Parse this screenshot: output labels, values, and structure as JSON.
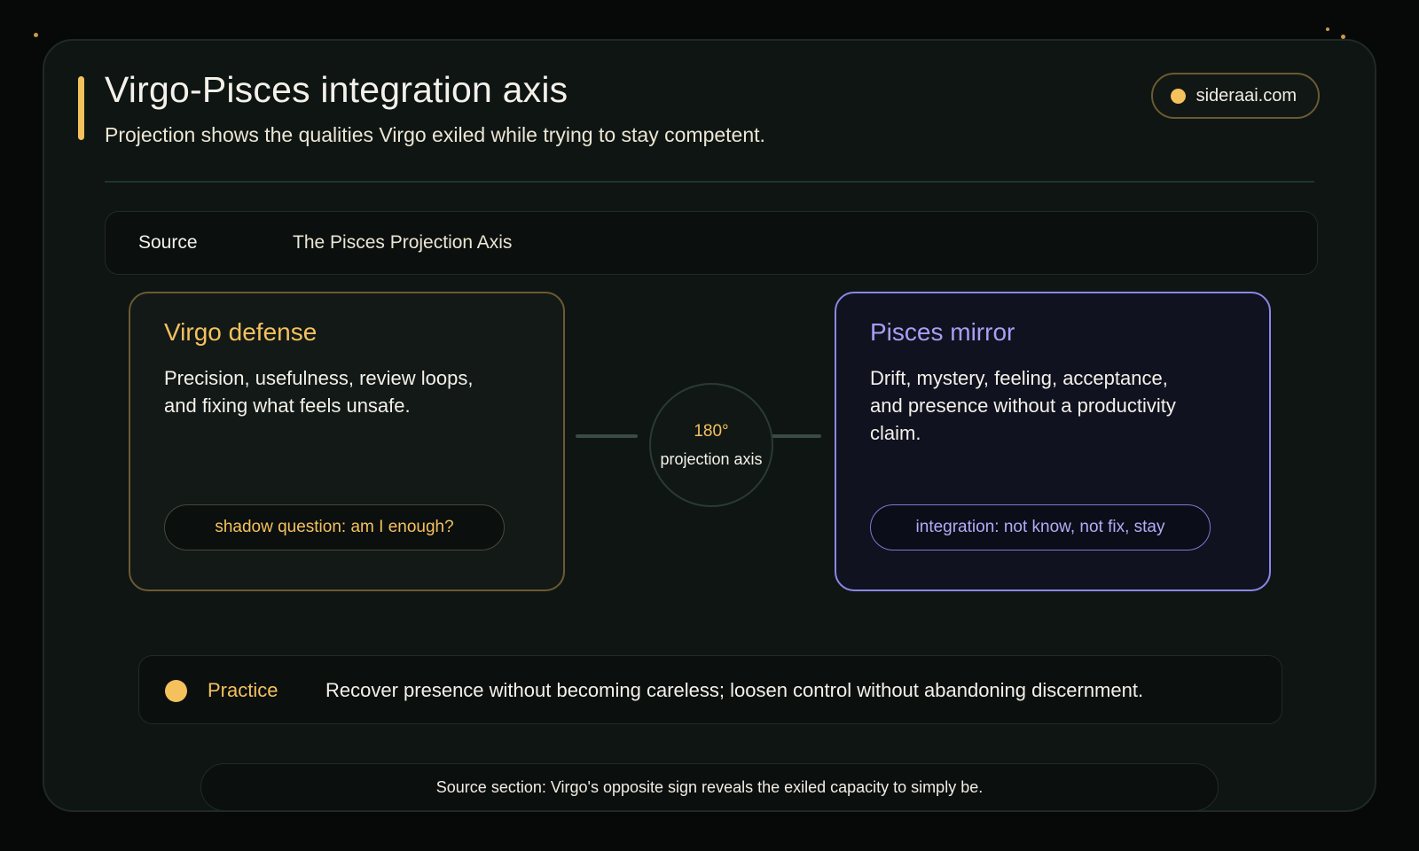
{
  "header": {
    "title": "Virgo-Pisces integration axis",
    "subtitle": "Projection shows the qualities Virgo exiled while trying to stay competent.",
    "badge": "sideraai.com"
  },
  "source": {
    "label": "Source",
    "value": "The Pisces Projection Axis"
  },
  "left_panel": {
    "title": "Virgo defense",
    "body": "Precision, usefulness, review loops, and fixing what feels unsafe.",
    "pill": "shadow question: am I enough?"
  },
  "axis": {
    "degrees": "180°",
    "label": "projection axis"
  },
  "right_panel": {
    "title": "Pisces mirror",
    "body": "Drift, mystery, feeling, acceptance, and presence without a productivity claim.",
    "pill": "integration: not know, not fix, stay"
  },
  "practice": {
    "label": "Practice",
    "text": "Recover presence without becoming careless; loosen control without abandoning discernment."
  },
  "footer": {
    "text": "Source section: Virgo's opposite sign reveals the exiled capacity to simply be."
  },
  "colors": {
    "accent_gold": "#f4c15d",
    "accent_violet": "#a99ef5",
    "background": "#070909",
    "card": "#0f1513"
  }
}
